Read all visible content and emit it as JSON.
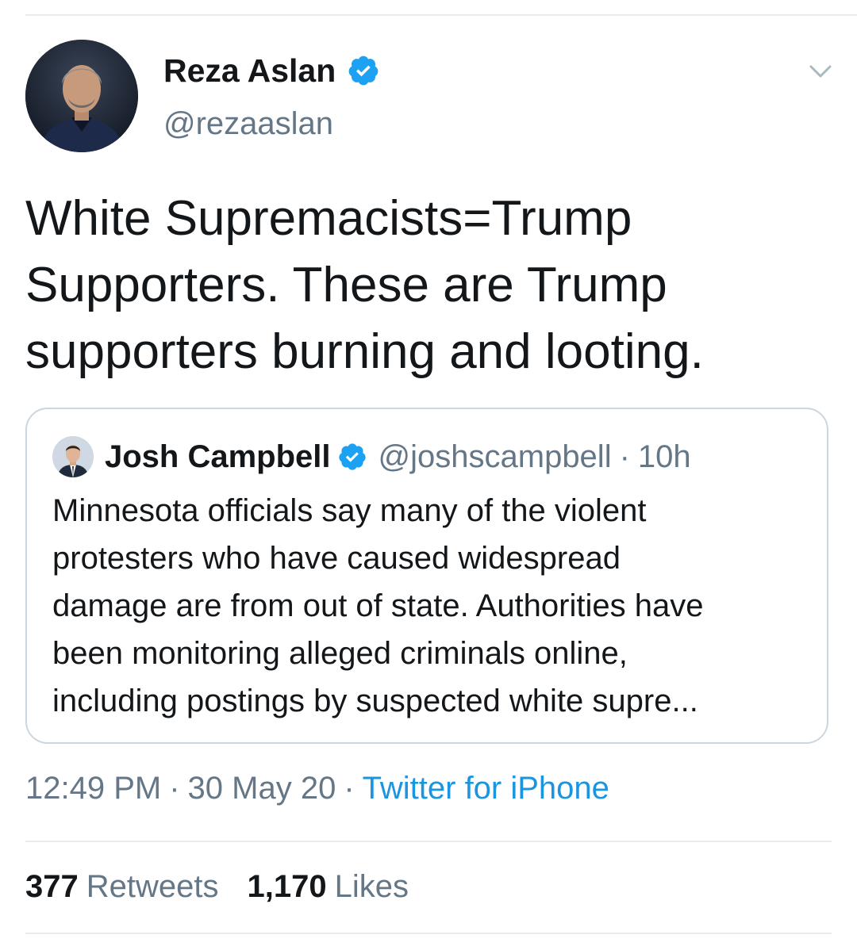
{
  "tweet": {
    "author": {
      "display_name": "Reza Aslan",
      "handle": "@rezaaslan",
      "verified": true,
      "avatar_icon": "profile-photo"
    },
    "menu_icon": "chevron-down-icon",
    "text_lines": [
      "White Supremacists=Trump",
      "Supporters. These are Trump",
      "supporters burning and looting."
    ],
    "quoted": {
      "display_name": "Josh Campbell",
      "handle": "@joshscampbell",
      "separator": "·",
      "time": "10h",
      "verified": true,
      "text_lines": [
        "Minnesota officials say many of the violent",
        "protesters who have caused widespread",
        "damage are from out of state. Authorities have",
        "been monitoring alleged criminals online,",
        "including postings by suspected white supre..."
      ]
    },
    "meta": {
      "time": "12:49 PM",
      "date": "30 May 20",
      "separator": "·",
      "source": "Twitter for iPhone"
    },
    "stats": {
      "retweets_count": "377",
      "retweets_label": "Retweets",
      "likes_count": "1,170",
      "likes_label": "Likes"
    }
  },
  "colors": {
    "text_primary": "#14171a",
    "text_secondary": "#657786",
    "link": "#1b95e0",
    "verified_badge": "#1da1f2",
    "divider": "#e6ecf0",
    "quote_border": "#ccd6dd"
  }
}
